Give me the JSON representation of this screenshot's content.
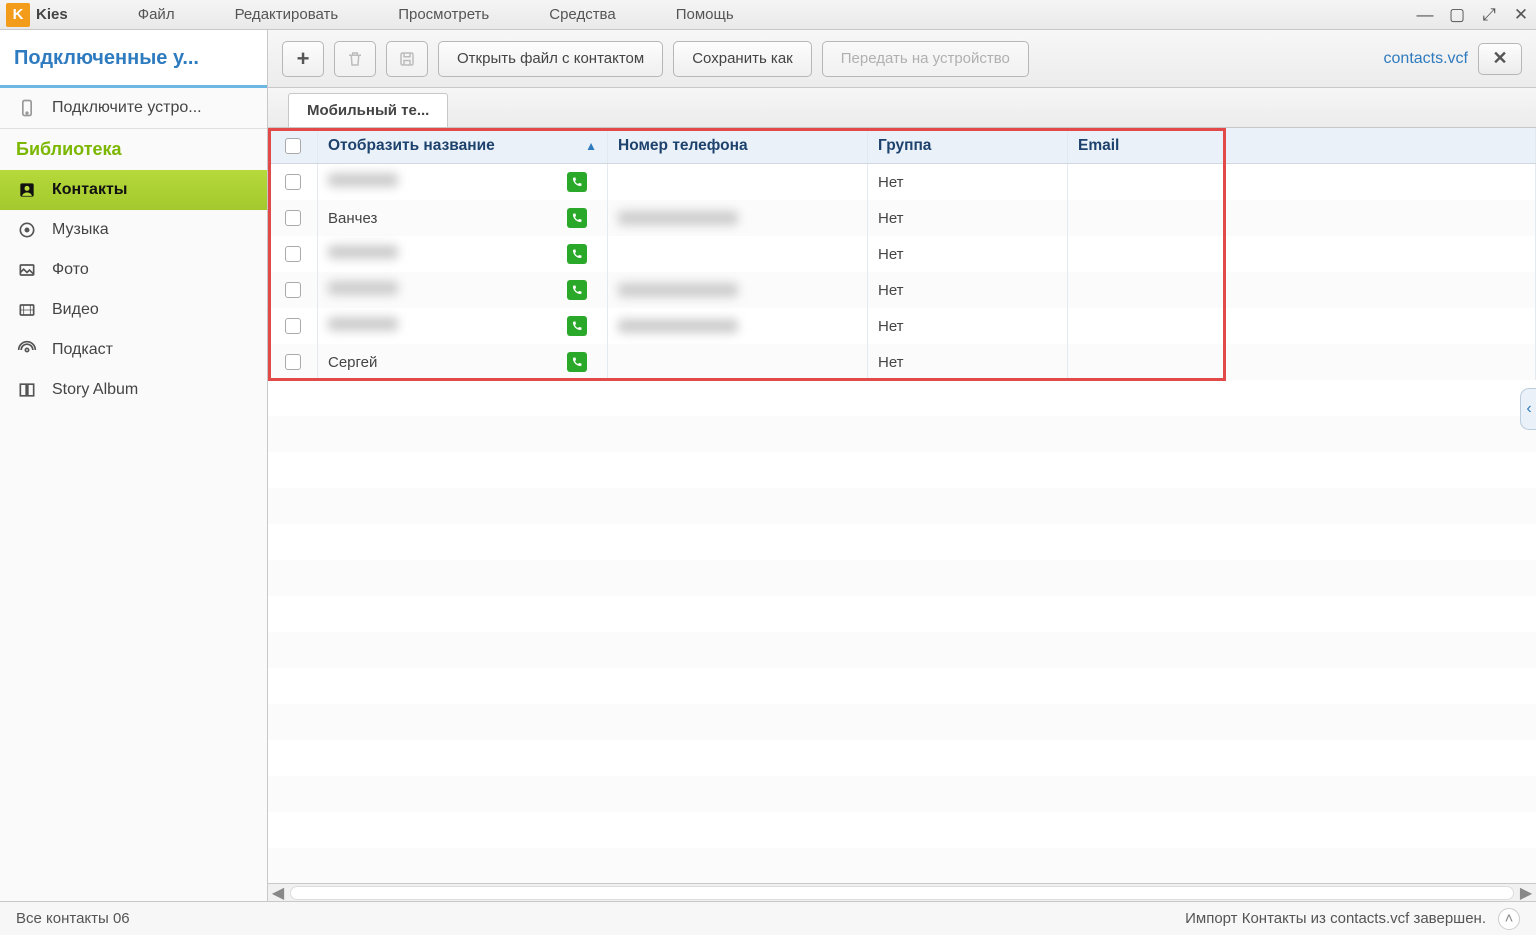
{
  "app": {
    "name": "Kies"
  },
  "menu": {
    "file": "Файл",
    "edit": "Редактировать",
    "view": "Просмотреть",
    "tools": "Средства",
    "help": "Помощь"
  },
  "sidebar": {
    "devices_heading": "Подключенные у...",
    "connect_device": "Подключите устро...",
    "library_heading": "Библиотека",
    "items": [
      {
        "label": "Контакты"
      },
      {
        "label": "Музыка"
      },
      {
        "label": "Фото"
      },
      {
        "label": "Видео"
      },
      {
        "label": "Подкаст"
      },
      {
        "label": "Story Album"
      }
    ]
  },
  "toolbar": {
    "open_contact_file": "Открыть файл с контактом",
    "save_as": "Сохранить как",
    "send_to_device": "Передать на устройство",
    "filename": "contacts.vcf"
  },
  "tab": {
    "label": "Мобильный те..."
  },
  "columns": {
    "name": "Отобразить название",
    "phone": "Номер телефона",
    "group": "Группа",
    "email": "Email"
  },
  "rows": [
    {
      "name": "",
      "phone": "",
      "group": "Нет",
      "email": "",
      "blurred": true
    },
    {
      "name": "Ванчез",
      "phone": "",
      "group": "Нет",
      "email": "",
      "blurred_phone": true
    },
    {
      "name": "",
      "phone": "",
      "group": "Нет",
      "email": "",
      "blurred": true
    },
    {
      "name": "",
      "phone": "",
      "group": "Нет",
      "email": "",
      "blurred": true,
      "blurred_phone": true
    },
    {
      "name": "",
      "phone": "",
      "group": "Нет",
      "email": "",
      "blurred": true,
      "blurred_phone": true
    },
    {
      "name": "Сергей",
      "phone": "",
      "group": "Нет",
      "email": ""
    }
  ],
  "status": {
    "left": "Все контакты 06",
    "right": "Импорт Контакты из contacts.vcf завершен."
  }
}
